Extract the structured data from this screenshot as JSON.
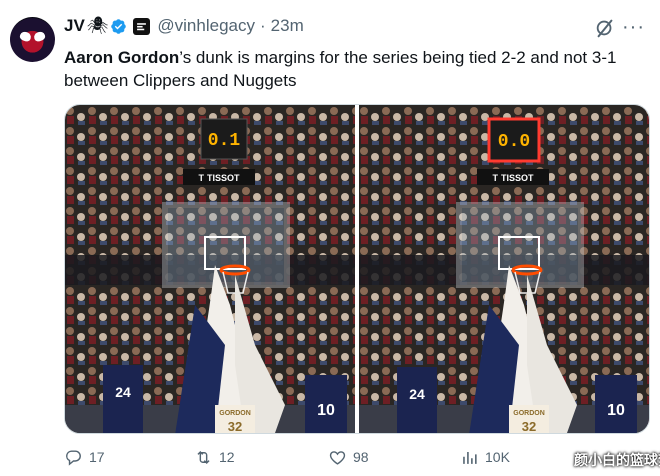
{
  "author": {
    "name": "JV",
    "name_emoji": "🕷",
    "handle": "@vinhlegacy",
    "separator": "·",
    "time": "23m"
  },
  "tweet": {
    "bold_name": "Aaron Gordon",
    "text": "’s dunk is margins for the series being tied 2-2 and not 3-1 between Clippers and Nuggets"
  },
  "media": {
    "left_clock": "0.1",
    "right_clock": "0.0",
    "sponsor": "TISSOT",
    "sponsor_mark": "T",
    "jersey_24": "24",
    "jersey_10": "10",
    "jersey_32": "32",
    "jersey_name": "GORDON"
  },
  "actions": {
    "replies": "17",
    "reposts": "12",
    "likes": "98",
    "views": "10K"
  },
  "watermark": "颜小白的篮球梦",
  "colors": {
    "text": "#0f1419",
    "secondary": "#536471",
    "verified": "#1d9bf0",
    "border": "#cfd9de",
    "clock_red": "#ff3b30",
    "clock_amber": "#ffb400"
  }
}
